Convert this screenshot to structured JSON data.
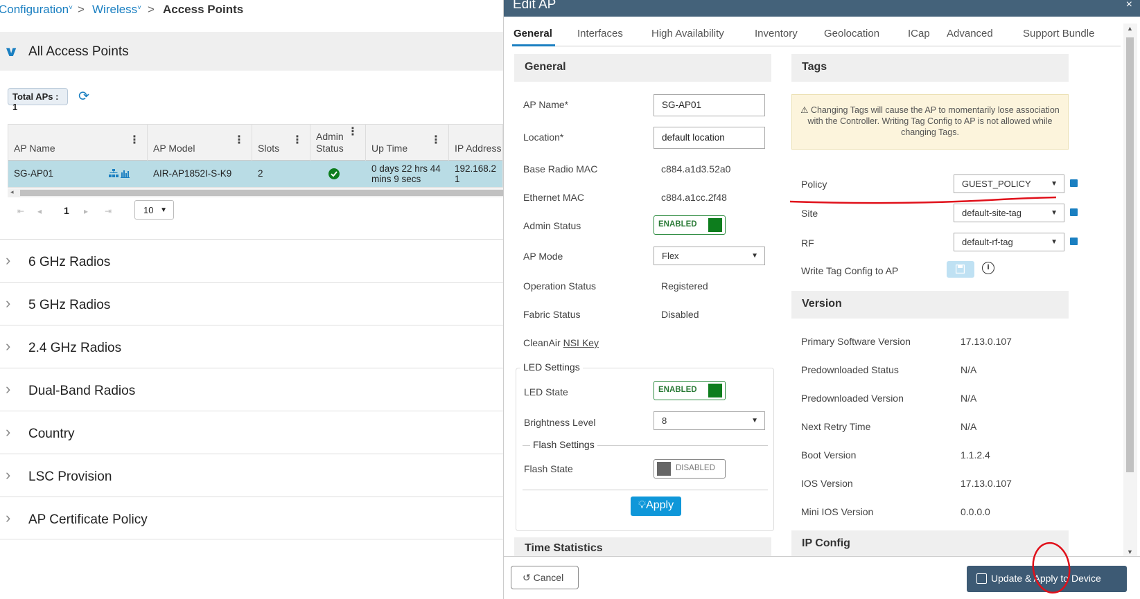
{
  "breadcrumb": {
    "items": [
      "Configuration",
      "Wireless",
      "Access Points"
    ],
    "caret": "˅",
    "separator": ">"
  },
  "all_aps": {
    "title": "All Access Points",
    "total_label": "Total APs : 1",
    "columns": [
      "AP Name",
      "AP Model",
      "Slots",
      "Admin Status",
      "Up Time",
      "IP Address"
    ],
    "row": {
      "ap_name": "SG-AP01",
      "ap_model": "AIR-AP1852I-S-K9",
      "slots": "2",
      "up_time": "0 days 22 hrs 44 mins 9 secs",
      "ip_address": "192.168.2\n1"
    },
    "page": "1",
    "page_size": "10"
  },
  "sections": [
    "6 GHz Radios",
    "5 GHz Radios",
    "2.4 GHz Radios",
    "Dual-Band Radios",
    "Country",
    "LSC Provision",
    "AP Certificate Policy"
  ],
  "modal": {
    "title": "Edit AP",
    "close": "×",
    "tabs": [
      "General",
      "Interfaces",
      "High Availability",
      "Inventory",
      "Geolocation",
      "ICap",
      "Advanced",
      "Support Bundle"
    ],
    "general": {
      "heading": "General",
      "ap_name_label": "AP Name*",
      "ap_name_value": "SG-AP01",
      "location_label": "Location*",
      "location_value": "default location",
      "base_mac_label": "Base Radio MAC",
      "base_mac_value": "c884.a1d3.52a0",
      "eth_mac_label": "Ethernet MAC",
      "eth_mac_value": "c884.a1cc.2f48",
      "admin_status_label": "Admin Status",
      "admin_status_value": "ENABLED",
      "ap_mode_label": "AP Mode",
      "ap_mode_value": "Flex",
      "op_status_label": "Operation Status",
      "op_status_value": "Registered",
      "fabric_label": "Fabric Status",
      "fabric_value": "Disabled",
      "cleanair_label": "CleanAir",
      "cleanair_link": "NSI Key",
      "led_settings": "LED Settings",
      "led_state_label": "LED State",
      "led_state_value": "ENABLED",
      "brightness_label": "Brightness Level",
      "brightness_value": "8",
      "flash_settings": "Flash Settings",
      "flash_state_label": "Flash State",
      "flash_state_value": "DISABLED",
      "apply": "Apply",
      "time_stats": "Time Statistics"
    },
    "tags": {
      "heading": "Tags",
      "warning": "Changing Tags will cause the AP to momentarily lose association with the Controller. Writing Tag Config to AP is not allowed while changing Tags.",
      "policy_label": "Policy",
      "policy_value": "GUEST_POLICY",
      "site_label": "Site",
      "site_value": "default-site-tag",
      "rf_label": "RF",
      "rf_value": "default-rf-tag",
      "write_label": "Write Tag Config to AP"
    },
    "version": {
      "heading": "Version",
      "rows": [
        {
          "label": "Primary Software Version",
          "value": "17.13.0.107"
        },
        {
          "label": "Predownloaded Status",
          "value": "N/A"
        },
        {
          "label": "Predownloaded Version",
          "value": "N/A"
        },
        {
          "label": "Next Retry Time",
          "value": "N/A"
        },
        {
          "label": "Boot Version",
          "value": "1.1.2.4"
        },
        {
          "label": "IOS Version",
          "value": "17.13.0.107"
        },
        {
          "label": "Mini IOS Version",
          "value": "0.0.0.0"
        }
      ]
    },
    "ip_config": "IP Config",
    "footer": {
      "cancel": "Cancel",
      "update": "Update & Apply to Device"
    }
  },
  "colors": {
    "accent": "#1a7fc1",
    "modal_header": "#44627a",
    "enabled_green": "#0d7d1d",
    "selected_row": "#b9dce5",
    "annotation_red": "#e0101a"
  }
}
